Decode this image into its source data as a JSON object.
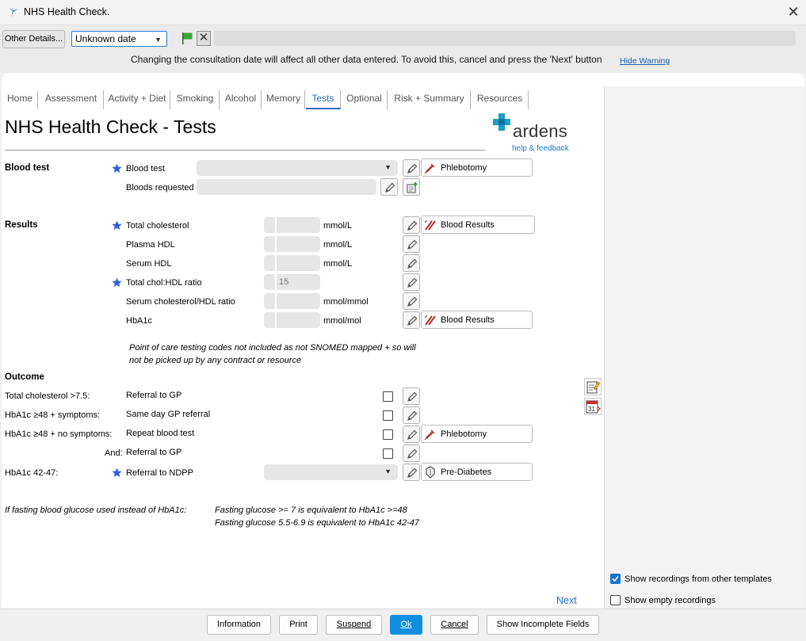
{
  "window": {
    "title": "NHS Health Check."
  },
  "toolbar": {
    "other_details": "Other Details...",
    "date_value": "Unknown date",
    "warning": "Changing the consultation date will affect all other data entered. To avoid this, cancel and press the 'Next' button",
    "hide_warning": "Hide Warning"
  },
  "tabs": [
    "Home",
    "Assessment",
    "Activity + Diet",
    "Smoking",
    "Alcohol",
    "Memory",
    "Tests",
    "Optional",
    "Risk + Summary",
    "Resources"
  ],
  "active_tab": "Tests",
  "page": {
    "title": "NHS Health Check - Tests",
    "logo_text": "ardens",
    "help_link": "help & feedback"
  },
  "blood_test": {
    "section": "Blood test",
    "row1_label": "Blood test",
    "row1_link": "Phlebotomy",
    "row2_label": "Bloods requested"
  },
  "results": {
    "section": "Results",
    "rows": [
      {
        "label": "Total cholesterol",
        "unit": "mmol/L",
        "value": "",
        "link": "Blood Results"
      },
      {
        "label": "Plasma HDL",
        "unit": "mmol/L",
        "value": ""
      },
      {
        "label": "Serum HDL",
        "unit": "mmol/L",
        "value": ""
      },
      {
        "label": "Total chol:HDL ratio",
        "unit": "",
        "value": "15"
      },
      {
        "label": "Serum cholesterol/HDL ratio",
        "unit": "mmol/mmol",
        "value": ""
      },
      {
        "label": "HbA1c",
        "unit": "mmol/mol",
        "value": "",
        "link": "Blood Results"
      }
    ],
    "note_line1": "Point of care testing codes not included as not SNOMED mapped + so will",
    "note_line2": "not be picked up by any contract or resource"
  },
  "outcome": {
    "section": "Outcome",
    "rows": [
      {
        "condition": "Total cholesterol >7.5:",
        "action": "Referral to GP"
      },
      {
        "condition": "HbA1c ≥48 + symptoms:",
        "action": "Same day GP referral"
      },
      {
        "condition": "HbA1c ≥48 + no symptoms:",
        "action": "Repeat blood test",
        "link": "Phlebotomy"
      },
      {
        "condition": "And:",
        "action": "Referral to GP"
      },
      {
        "condition": "HbA1c 42-47:",
        "action": "Referral to NDPP",
        "link": "Pre-Diabetes"
      }
    ]
  },
  "glucose_note": {
    "label": "If fasting blood glucose used instead of HbA1c:",
    "line1": "Fasting glucose >= 7 is equivalent to HbA1c >=48",
    "line2": "Fasting glucose 5.5-6.9 is equivalent to HbA1c 42-47"
  },
  "next": "Next",
  "side": {
    "show_other": {
      "label": "Show recordings from other templates",
      "checked": true
    },
    "show_empty": {
      "label": "Show empty recordings",
      "checked": false
    }
  },
  "footer": {
    "information": "Information",
    "print": "Print",
    "suspend": "Suspend",
    "ok": "Ok",
    "cancel": "Cancel",
    "show_incomplete": "Show Incomplete Fields"
  },
  "colors": {
    "accent": "#1f6fbf",
    "primary_button": "#0e8fdf",
    "star": "#2f5fe0",
    "flag": "#3aa33a"
  }
}
